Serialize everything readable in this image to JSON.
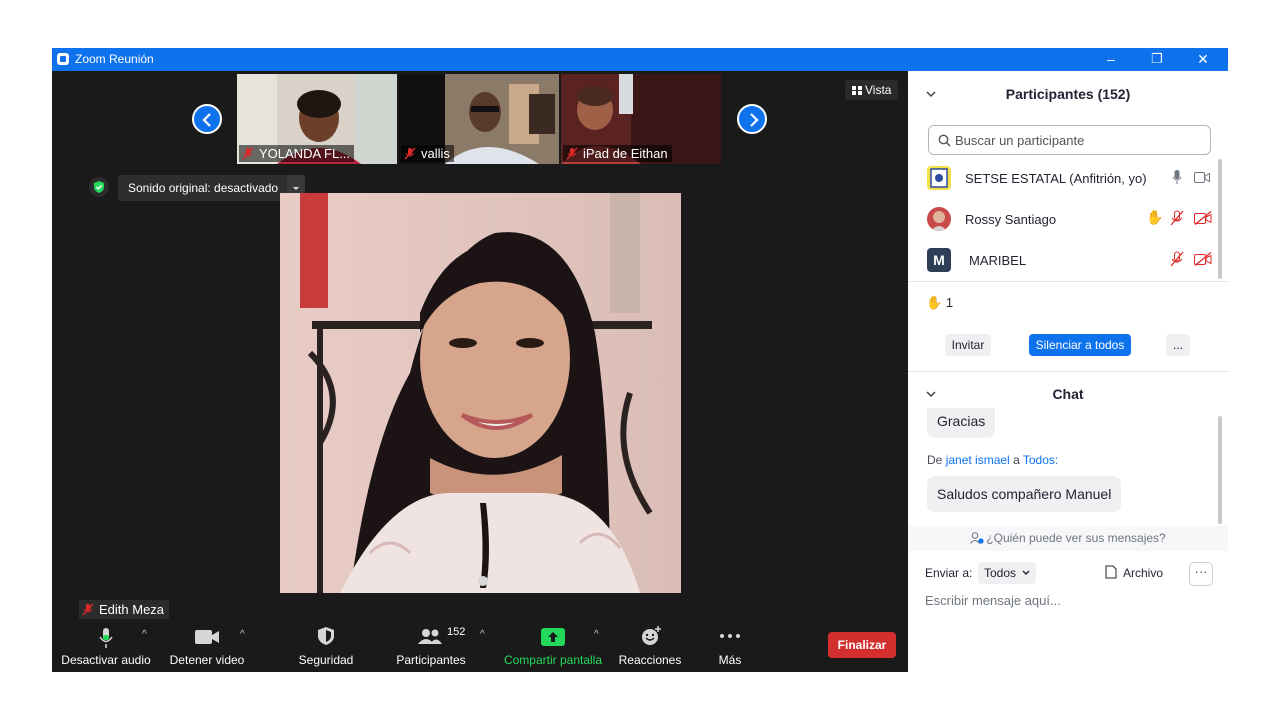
{
  "window": {
    "title": "Zoom Reunión",
    "minimize": "–",
    "restore": "❐",
    "close": "✕"
  },
  "gallery": {
    "thumbs": [
      {
        "name": "YOLANDA FL..."
      },
      {
        "name": "vallis"
      },
      {
        "name": "iPad de Eithan"
      }
    ],
    "view_label": "Vista"
  },
  "audio_bar": {
    "sound_label": "Sonido original: desactivado"
  },
  "speaker": {
    "name": "Edith Meza"
  },
  "toolbar": {
    "audio": "Desactivar audio",
    "video": "Detener video",
    "security": "Seguridad",
    "participants": "Participantes",
    "participants_count": "152",
    "share": "Compartir pantalla",
    "reactions": "Reacciones",
    "more": "Más",
    "end": "Finalizar"
  },
  "participants_panel": {
    "title": "Participantes (152)",
    "search_placeholder": "Buscar un participante",
    "rows": [
      {
        "name": "SETSE ESTATAL (Anfitrión, yo)"
      },
      {
        "name": "Rossy Santiago"
      },
      {
        "name": "MARIBEL",
        "initial": "M"
      }
    ],
    "raised_hands": "1",
    "invite": "Invitar",
    "mute_all": "Silenciar a todos",
    "more": "..."
  },
  "chat_panel": {
    "title": "Chat",
    "prev_message": "Gracias",
    "from_prefix": "De",
    "sender": "janet ismael",
    "to_word": "a",
    "recipient": "Todos:",
    "message": "Saludos compañero Manuel",
    "who_can_see": "¿Quién puede ver sus mensajes?",
    "send_to_label": "Enviar a:",
    "send_to_value": "Todos",
    "file_label": "Archivo",
    "more": "···",
    "input_placeholder": "Escribir mensaje aquí..."
  },
  "colors": {
    "titlebar": "#0e72ed",
    "end_button": "#d42f2f",
    "share_green": "#23d959",
    "link_blue": "#0e72ed",
    "muted_red": "#e02828"
  }
}
